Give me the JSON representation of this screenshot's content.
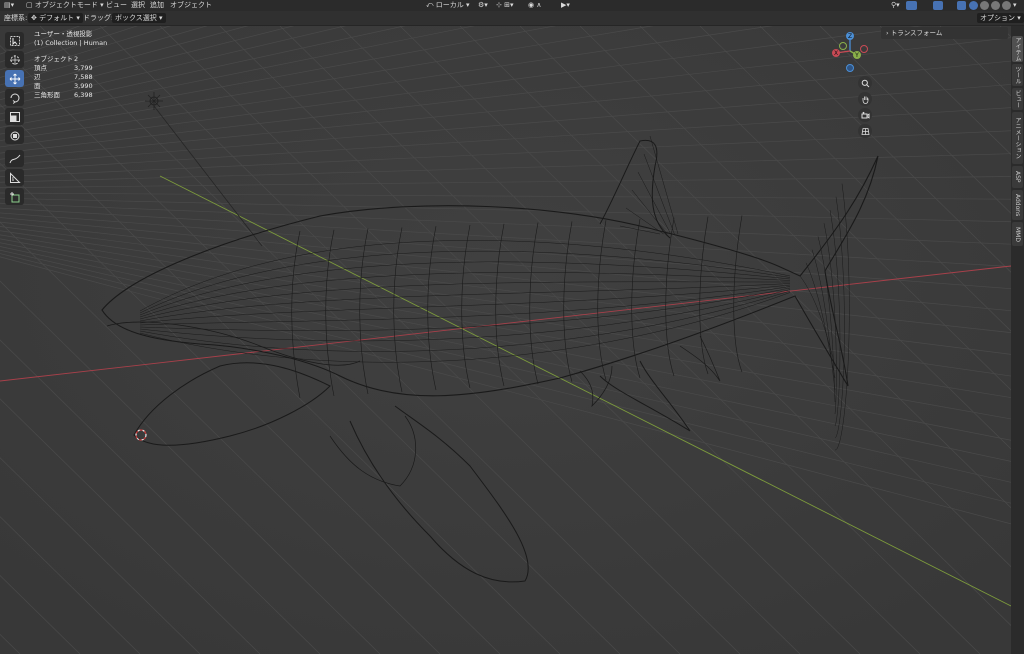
{
  "header": {
    "object_mode": "オブジェクトモード",
    "menu": [
      "ビュー",
      "選択",
      "追加",
      "オブジェクト"
    ],
    "transform_orientation": "ローカル",
    "options_label": "オプション"
  },
  "tool_header": {
    "coord_label": "座標系:",
    "coord_value": "デフォルト",
    "drag_label": "ドラッグ:",
    "drag_value": "ボックス選択"
  },
  "overlay": {
    "view_name": "ユーザー・透視投影",
    "collection": "(1) Collection | Human",
    "stats": [
      {
        "label": "オブジェクト",
        "value": "2"
      },
      {
        "label": "頂点",
        "value": "3,799"
      },
      {
        "label": "辺",
        "value": "7,588"
      },
      {
        "label": "面",
        "value": "3,990"
      },
      {
        "label": "三角形面",
        "value": "6,398"
      }
    ]
  },
  "npanel": {
    "transform_label": "トランスフォーム"
  },
  "sidebar_tabs": [
    "アイテム",
    "ツール",
    "ビュー",
    "アニメーション",
    "ASP",
    "Addons",
    "MMD"
  ],
  "gizmo": {
    "z": "Z",
    "y": "Y",
    "x": "X"
  },
  "colors": {
    "x_axis": "#c94a55",
    "y_axis": "#8ab04a",
    "z_axis": "#4b8fd6",
    "active_tool": "#4772b3"
  },
  "tools": [
    "select-box-tool",
    "cursor-tool",
    "move-tool",
    "rotate-tool",
    "scale-tool",
    "transform-tool",
    "annotate-tool",
    "measure-tool",
    "add-cube-tool"
  ],
  "nav_icons": [
    "zoom-icon",
    "hand-pan-icon",
    "camera-icon",
    "grid-view-icon"
  ]
}
